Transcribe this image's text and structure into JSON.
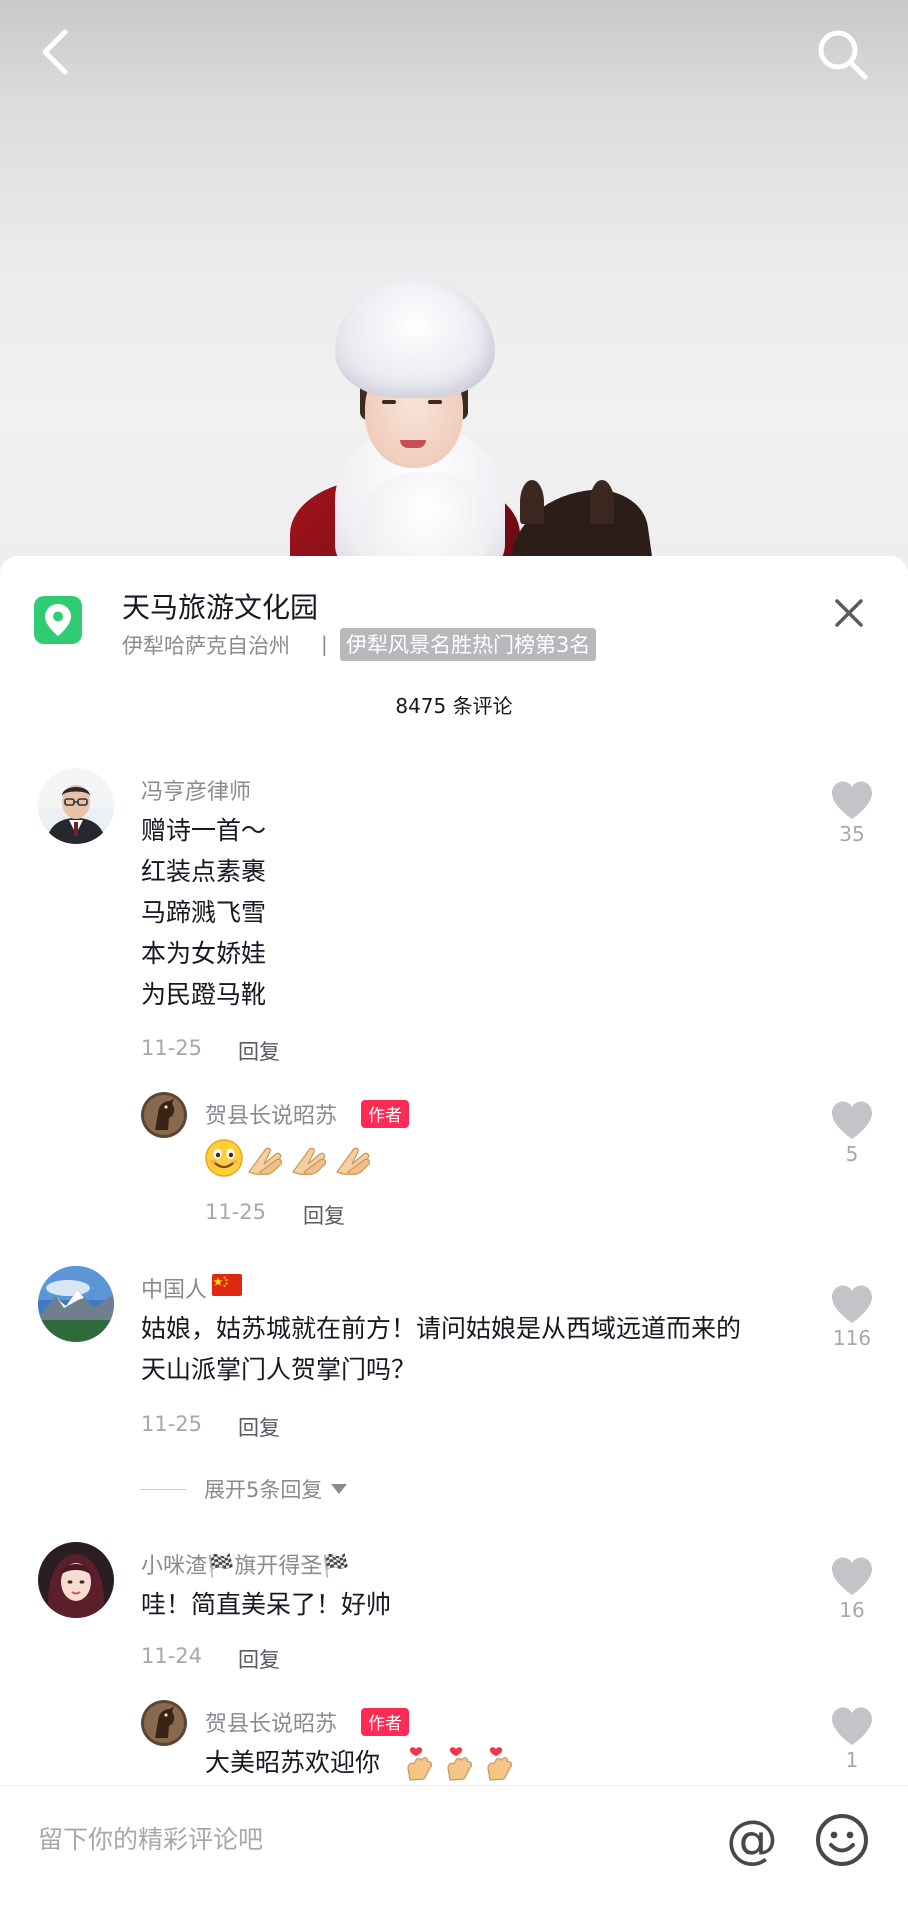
{
  "poi": {
    "name": "天马旅游文化园",
    "region": "伊犁哈萨克自治州",
    "separator": "|",
    "rank": "伊犁风景名胜热门榜第3名"
  },
  "comments_count": "8475 条评论",
  "comments": [
    {
      "nickname": "冯亨彦律师",
      "lines": [
        "赠诗一首～",
        "红装点素裹",
        "马蹄溅飞雪",
        "本为女娇娃",
        "为民蹬马靴"
      ],
      "date": "11-25",
      "reply_label": "回复",
      "likes": "35"
    },
    {
      "nickname": "中国人",
      "lines": [
        "姑娘，姑苏城就在前方！请问姑娘是从西域远道而来的",
        "天山派掌门人贺掌门吗？"
      ],
      "date": "11-25",
      "reply_label": "回复",
      "likes": "116",
      "expand_label": "展开5条回复"
    },
    {
      "nickname": "小咪渣🏁旗开得圣🏁",
      "lines": [
        "哇！简直美呆了！好帅"
      ],
      "date": "11-24",
      "reply_label": "回复",
      "likes": "16"
    }
  ],
  "replies": [
    {
      "nickname": "贺县长说昭苏",
      "badge": "作者",
      "date": "11-25",
      "reply_label": "回复",
      "likes": "5"
    },
    {
      "nickname": "贺县长说昭苏",
      "badge": "作者",
      "text": "大美昭苏欢迎你",
      "likes": "1"
    }
  ],
  "input": {
    "placeholder": "留下你的精彩评论吧",
    "at_symbol": "@"
  },
  "colors": {
    "accent_badge": "#fe2c55",
    "poi_green": "#2fcc71",
    "muted_text": "#8a8b91"
  },
  "icons": [
    "back-arrow-icon",
    "search-icon",
    "location-pin-icon",
    "close-icon",
    "heart-icon",
    "emoji-icon",
    "china-flag-icon",
    "heart-hands-icon",
    "pray-hands-icon",
    "smile-emoji-icon"
  ]
}
